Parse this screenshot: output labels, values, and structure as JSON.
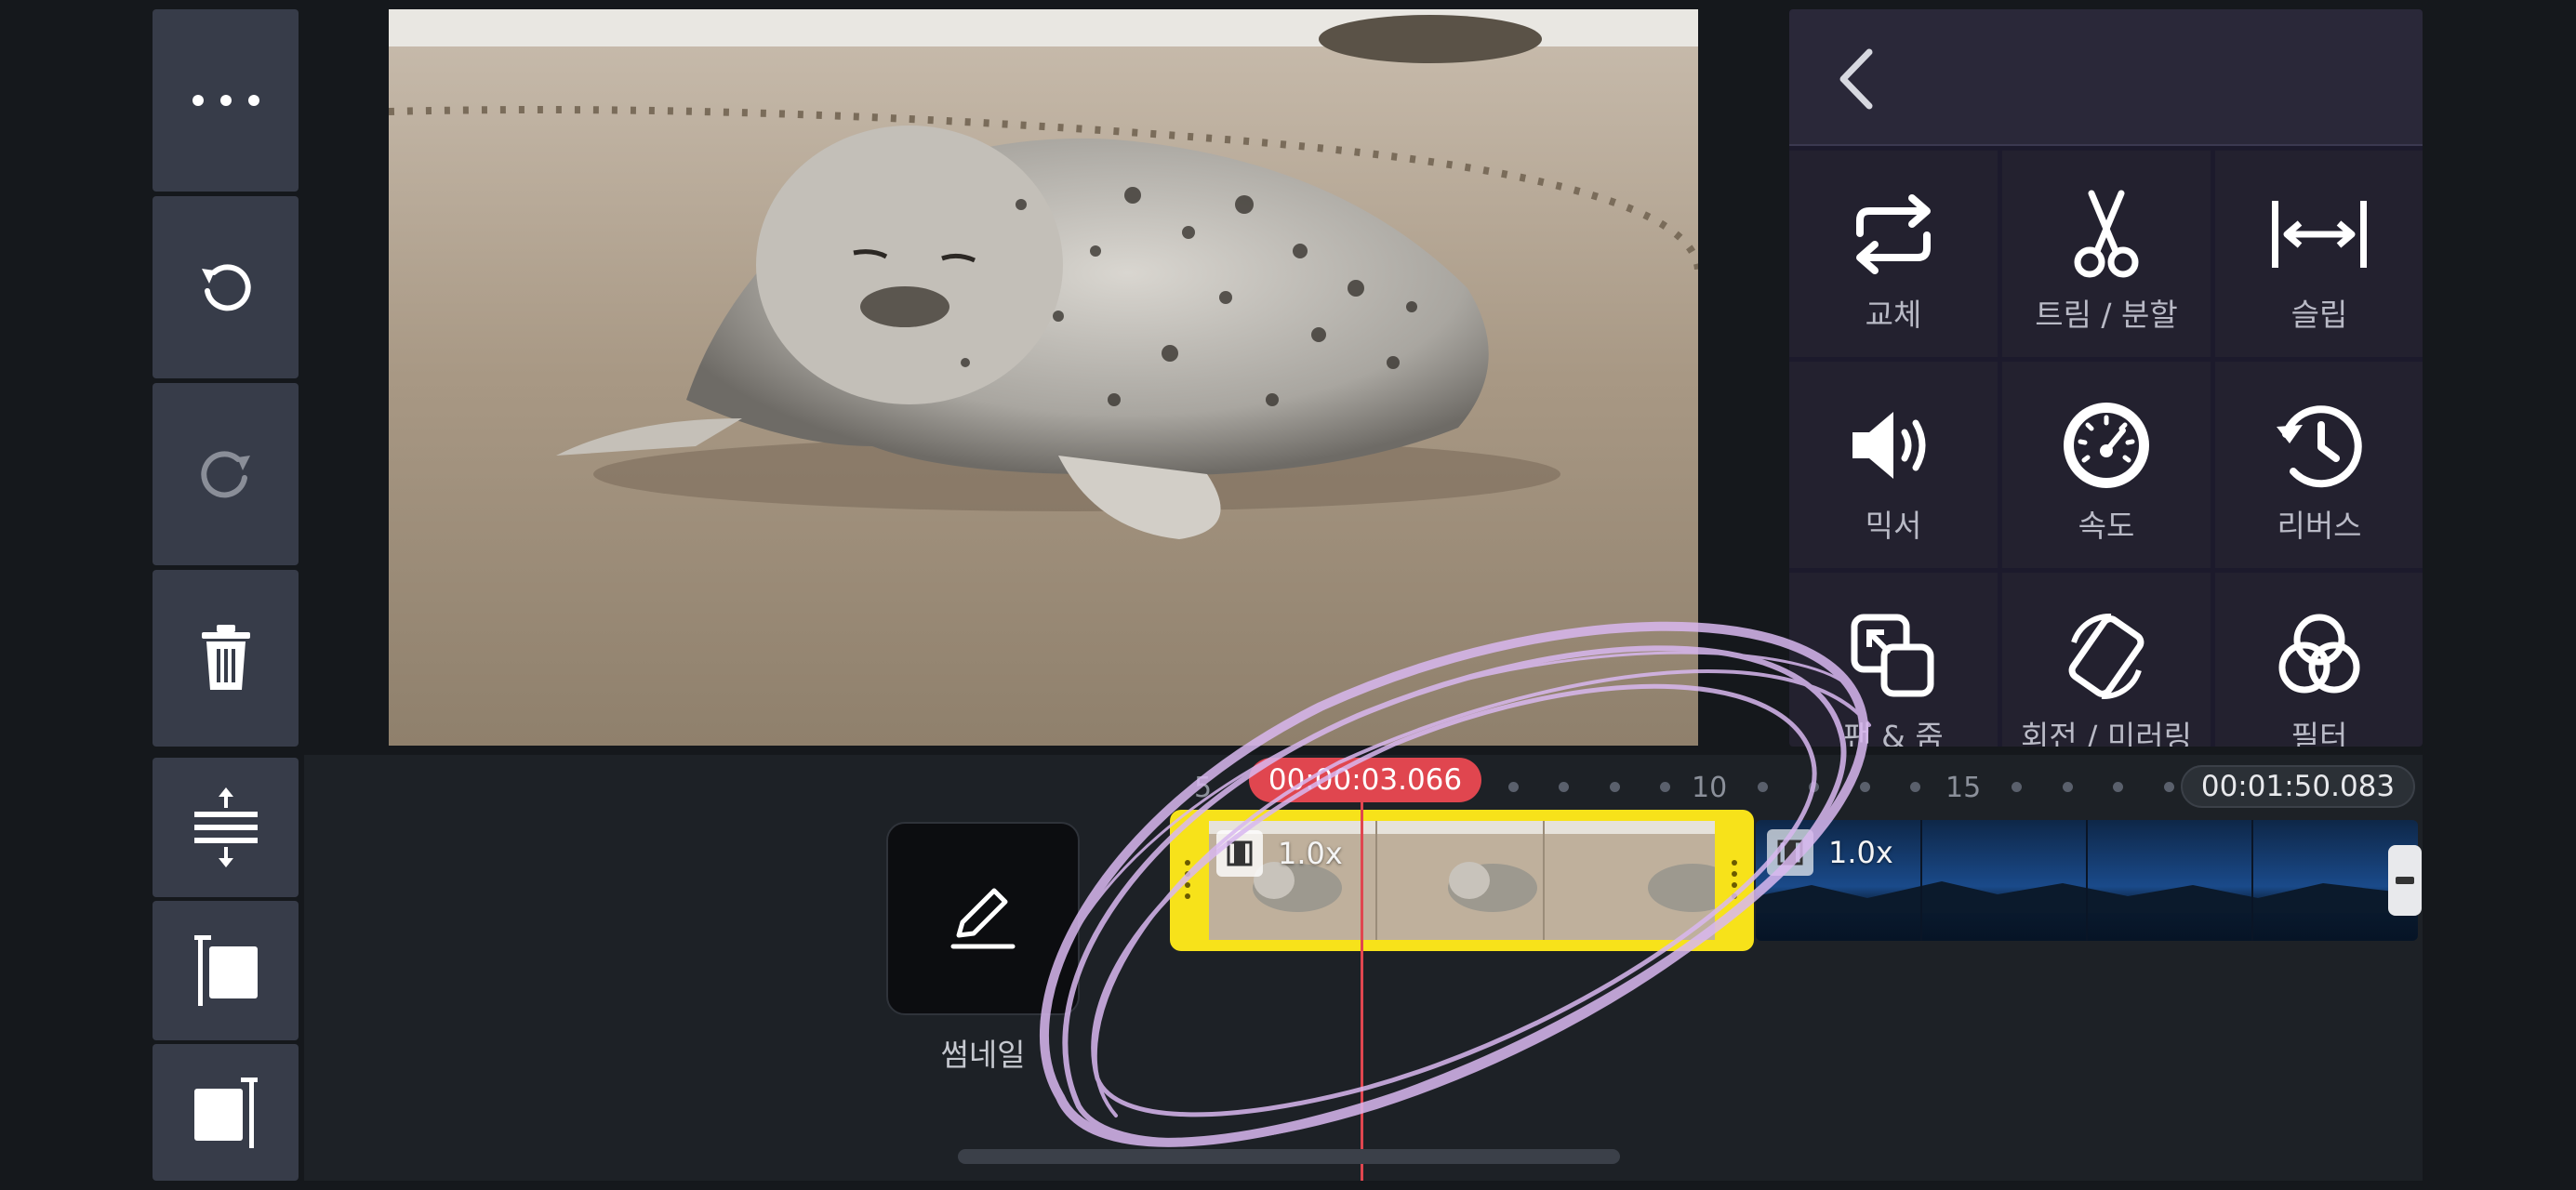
{
  "left_toolbar": {
    "items": [
      {
        "name": "more-icon"
      },
      {
        "name": "undo-icon"
      },
      {
        "name": "redo-icon"
      },
      {
        "name": "trash-icon"
      },
      {
        "name": "expand-timeline-icon"
      },
      {
        "name": "trim-start-icon"
      },
      {
        "name": "trim-end-icon"
      }
    ]
  },
  "right_panel": {
    "back_icon": "chevron-left-icon",
    "tools": [
      {
        "label": "교체",
        "icon": "replace-icon"
      },
      {
        "label": "트림 / 분할",
        "icon": "scissors-icon"
      },
      {
        "label": "슬립",
        "icon": "slip-icon"
      },
      {
        "label": "믹서",
        "icon": "speaker-icon"
      },
      {
        "label": "속도",
        "icon": "speedometer-icon"
      },
      {
        "label": "리버스",
        "icon": "reverse-clock-icon"
      },
      {
        "label": "팬 & 줌",
        "icon": "pan-zoom-icon"
      },
      {
        "label": "회전 / 미러링",
        "icon": "rotate-icon"
      },
      {
        "label": "필터",
        "icon": "filter-icon"
      }
    ]
  },
  "timeline": {
    "current_time": "00:00:03.066",
    "total_time": "00:01:50.083",
    "ruler_labels": [
      "5",
      "10",
      "15"
    ],
    "thumbnail_label": "썸네일",
    "clips": [
      {
        "speed": "1.0x",
        "selected": true
      },
      {
        "speed": "1.0x",
        "selected": false
      }
    ]
  },
  "colors": {
    "accent_playhead": "#e0464f",
    "selected_clip": "#f7e21a",
    "panel_bg": "#1c1a2c",
    "annotation": "#d9b8f0"
  }
}
